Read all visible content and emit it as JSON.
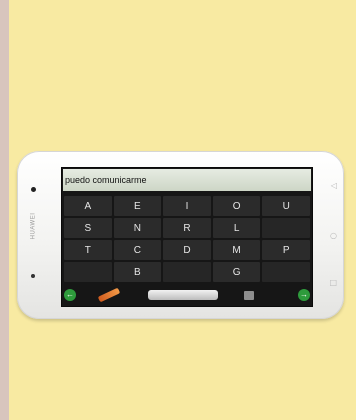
{
  "device": {
    "brand": "HUAWEI",
    "side_symbols": [
      "◁",
      "○",
      "□"
    ]
  },
  "app": {
    "text_field": "puedo comunicarme",
    "keys": [
      [
        "A",
        "E",
        "I",
        "O",
        "U"
      ],
      [
        "S",
        "N",
        "R",
        "L",
        ""
      ],
      [
        "T",
        "C",
        "D",
        "M",
        "P"
      ],
      [
        "",
        "B",
        "",
        "G",
        ""
      ]
    ],
    "bottom": {
      "left_icon": "back-arrow-icon",
      "right_icon": "forward-arrow-icon",
      "left_symbol": "←",
      "right_symbol": "→"
    }
  },
  "colors": {
    "background": "#f8eaa2",
    "accent_green": "#2e9b3c",
    "pencil_orange": "#e36f2c",
    "screen_bg": "#161616"
  }
}
